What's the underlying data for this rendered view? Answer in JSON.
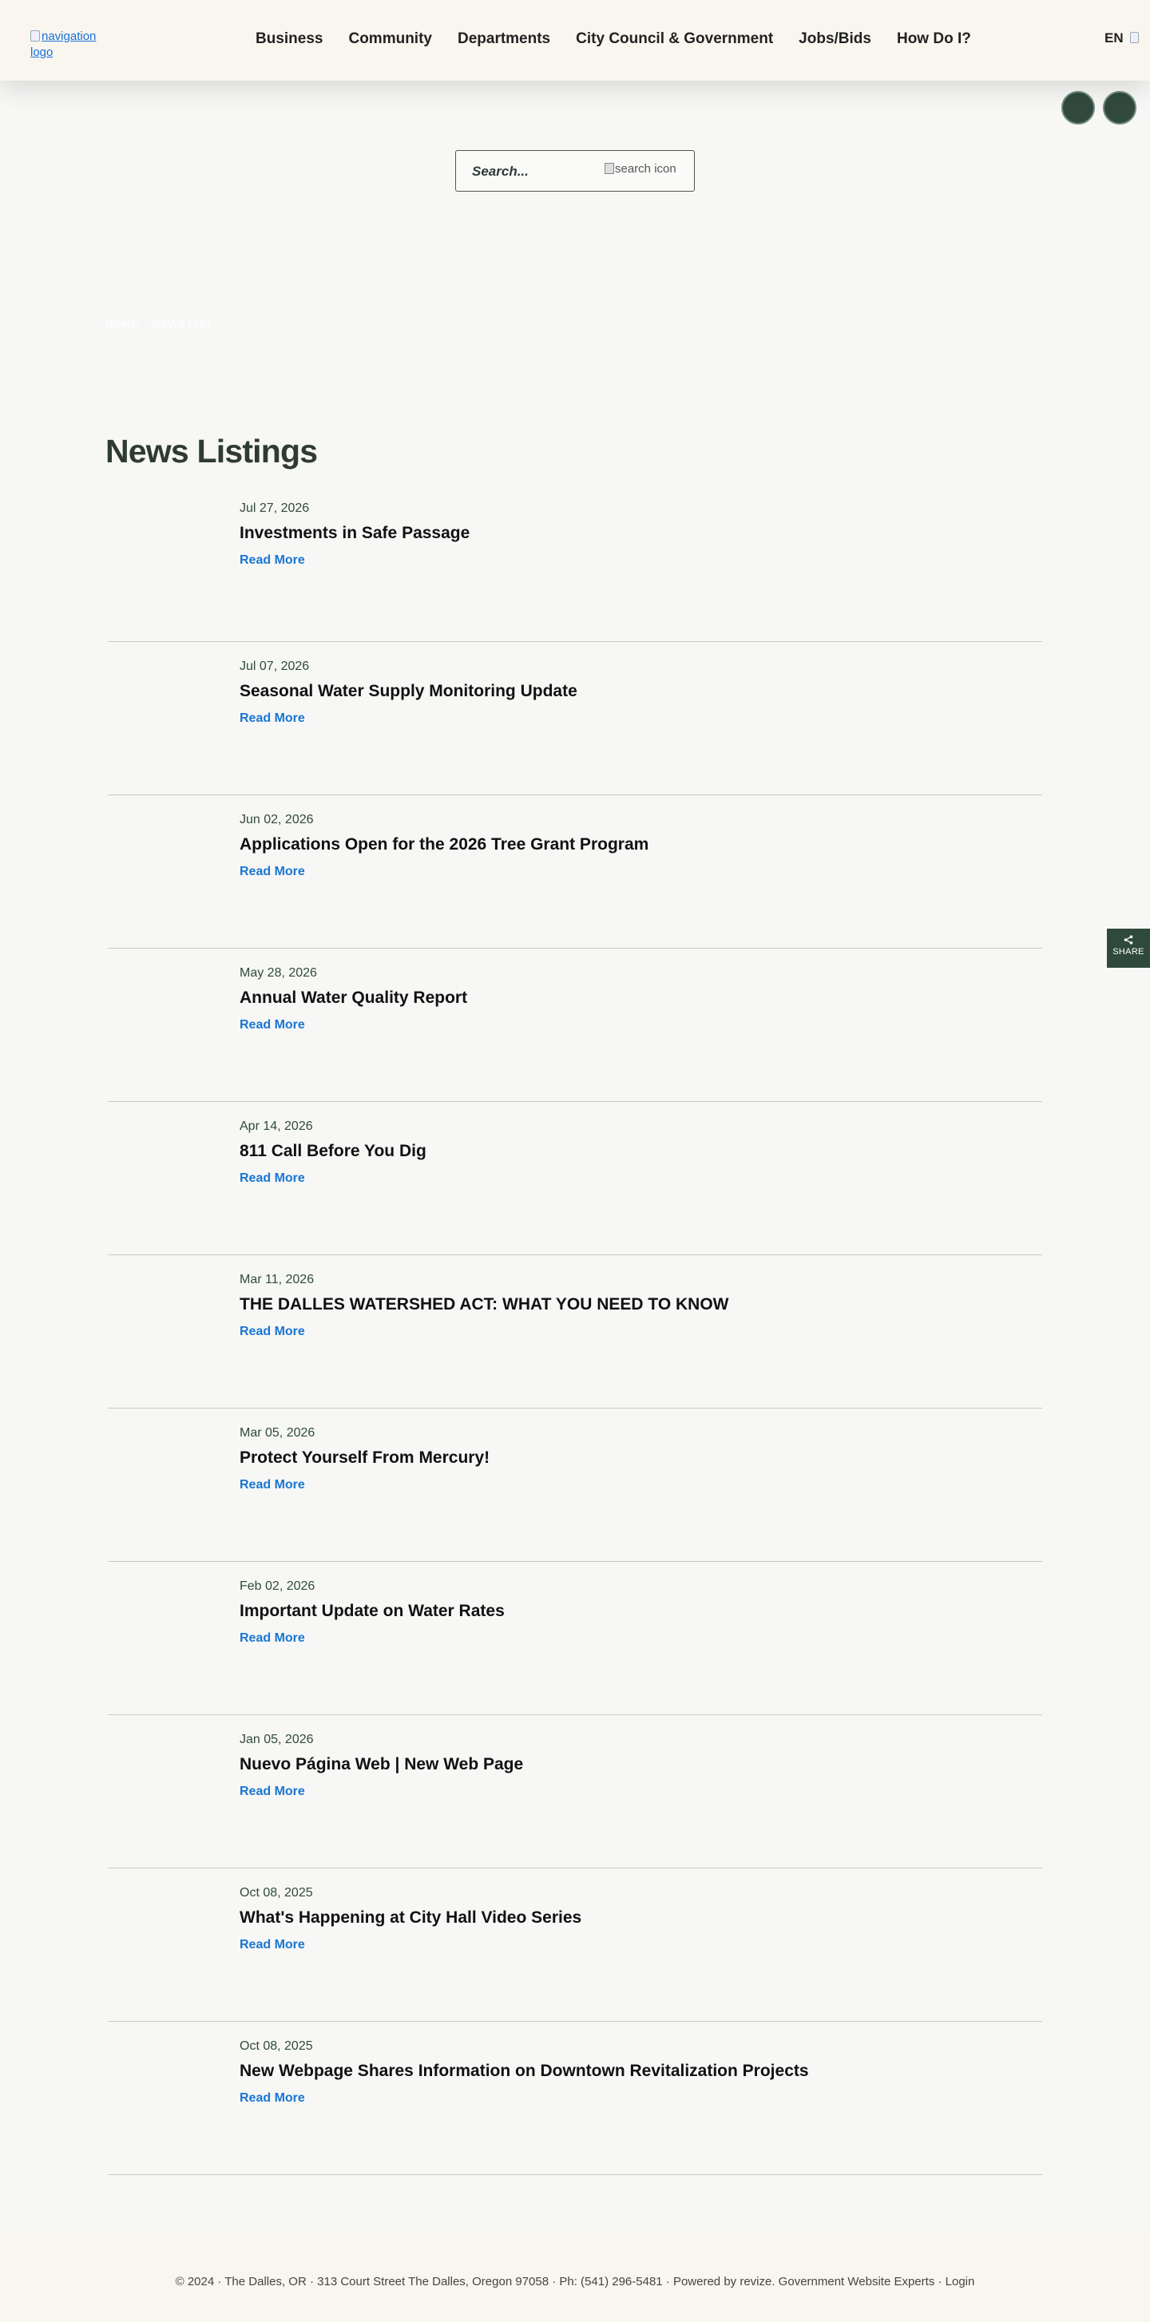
{
  "header": {
    "logo_alt": "navigation logo",
    "nav": [
      "Business",
      "Community",
      "Departments",
      "City Council & Government",
      "Jobs/Bids",
      "How Do I?"
    ],
    "language": "EN"
  },
  "search": {
    "placeholder": "Search...",
    "icon_alt": "search icon"
  },
  "breadcrumb": [
    "HOME",
    "NEWS LIST"
  ],
  "page": {
    "title": "News Listings"
  },
  "news": [
    {
      "date": "Jul 27, 2026",
      "title": "Investments in Safe Passage",
      "more": "Read More"
    },
    {
      "date": "Jul 07, 2026",
      "title": "Seasonal Water Supply Monitoring Update",
      "more": "Read More"
    },
    {
      "date": "Jun 02, 2026",
      "title": "Applications Open for the 2026 Tree Grant Program",
      "more": "Read More"
    },
    {
      "date": "May 28, 2026",
      "title": "Annual Water Quality Report",
      "more": "Read More"
    },
    {
      "date": "Apr 14, 2026",
      "title": "811 Call Before You Dig",
      "more": "Read More"
    },
    {
      "date": "Mar 11, 2026",
      "title": "THE DALLES WATERSHED ACT: WHAT YOU NEED TO KNOW",
      "more": "Read More"
    },
    {
      "date": "Mar 05, 2026",
      "title": "Protect Yourself From Mercury!",
      "more": "Read More"
    },
    {
      "date": "Feb 02, 2026",
      "title": "Important Update on Water Rates",
      "more": "Read More"
    },
    {
      "date": "Jan 05, 2026",
      "title": "Nuevo Página Web | New Web Page",
      "more": "Read More"
    },
    {
      "date": "Oct 08, 2025",
      "title": "What's Happening at City Hall Video Series",
      "more": "Read More"
    },
    {
      "date": "Oct 08, 2025",
      "title": "New Webpage Shares Information on Downtown Revitalization Projects",
      "more": "Read More"
    }
  ],
  "share": {
    "label": "SHARE",
    "icon": "share-icon"
  },
  "footer": {
    "text": "© 2024 · The Dalles, OR · 313 Court Street The Dalles, Oregon 97058 · Ph: (541) 296-5481 · Powered by revize. Government Website Experts · Login"
  },
  "colors": {
    "header_bg": "#f8f6ef",
    "page_bg": "#f7f7f6",
    "title_green": "#2f3b32",
    "link_blue": "#1976d2",
    "share_bg": "#2f4a3c"
  }
}
